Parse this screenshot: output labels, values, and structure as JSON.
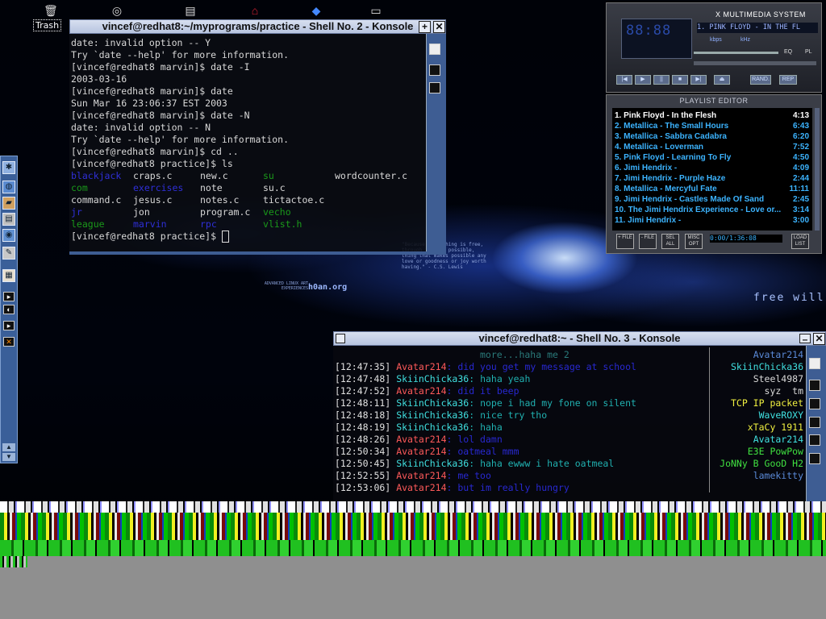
{
  "desktop": {
    "trash_label": "Trash",
    "wallpaper_free_will": "free will",
    "wallpaper_h0an": "h0an.org",
    "wallpaper_quote": "\"Because if a thing is free, through it also possible, thing that makes possible any love or goodness or joy worth having.\" - C.S. Lewis",
    "wallpaper_adv": "ADVANCED LINUX ART EXPERIENCES"
  },
  "shell2": {
    "title": "vincef@redhat8:~/myprograms/practice - Shell No. 2 - Konsole",
    "lines": [
      "date: invalid option -- Y",
      "Try `date --help' for more information.",
      "[vincef@redhat8 marvin]$ date -I",
      "2003-03-16",
      "[vincef@redhat8 marvin]$ date",
      "Sun Mar 16 23:06:37 EST 2003",
      "[vincef@redhat8 marvin]$ date -N",
      "date: invalid option -- N",
      "Try `date --help' for more information.",
      "[vincef@redhat8 marvin]$ cd ..",
      "[vincef@redhat8 practice]$ ls"
    ],
    "ls": [
      [
        "blackjack",
        "craps.c",
        "new.c",
        "su",
        "wordcounter.c"
      ],
      [
        "com",
        "exercises",
        "note",
        "su.c",
        ""
      ],
      [
        "command.c",
        "jesus.c",
        "notes.c",
        "tictactoe.c",
        ""
      ],
      [
        "jr",
        "jon",
        "program.c",
        "vecho",
        ""
      ],
      [
        "league",
        "marvin",
        "rpc",
        "vlist.h",
        ""
      ]
    ],
    "prompt": "[vincef@redhat8 practice]$ "
  },
  "shell3": {
    "title": "vincef@redhat8:~ - Shell No. 3 - Konsole",
    "top_line": "more...haha me 2",
    "chat": [
      {
        "ts": "[12:47:35]",
        "nick": "Avatar214",
        "msg": "did you get my message at school",
        "who": "a"
      },
      {
        "ts": "[12:47:48]",
        "nick": "SkiinChicka36",
        "msg": "haha yeah",
        "who": "s"
      },
      {
        "ts": "[12:47:52]",
        "nick": "Avatar214",
        "msg": "did it beep",
        "who": "a"
      },
      {
        "ts": "[12:48:11]",
        "nick": "SkiinChicka36",
        "msg": "nope i had my fone on silent",
        "who": "s"
      },
      {
        "ts": "[12:48:18]",
        "nick": "SkiinChicka36",
        "msg": "nice try tho",
        "who": "s"
      },
      {
        "ts": "[12:48:19]",
        "nick": "SkiinChicka36",
        "msg": "haha",
        "who": "s"
      },
      {
        "ts": "[12:48:26]",
        "nick": "Avatar214",
        "msg": "lol damn",
        "who": "a"
      },
      {
        "ts": "[12:50:34]",
        "nick": "Avatar214",
        "msg": "oatmeal mmm",
        "who": "a"
      },
      {
        "ts": "[12:50:45]",
        "nick": "SkiinChicka36",
        "msg": "haha ewww i hate oatmeal",
        "who": "s"
      },
      {
        "ts": "[12:52:55]",
        "nick": "Avatar214",
        "msg": "me too",
        "who": "a"
      },
      {
        "ts": "[12:53:06]",
        "nick": "Avatar214",
        "msg": "but im really hungry",
        "who": "a"
      }
    ],
    "users": [
      "Avatar214",
      "SkiinChicka36",
      "Steel4987",
      "syz  tm",
      "TCP IP packet",
      "WaveROXY",
      "xTaCy 1911",
      "Avatar214",
      "E3E PowPow",
      "JoNNy B GooD H2",
      "lamekitty"
    ]
  },
  "xmms": {
    "title": "X MULTIMEDIA SYSTEM",
    "time": "88:88",
    "track": "1. PINK FLOYD - IN THE FL",
    "kbps": "kbps",
    "khz": "kHz",
    "eq": "EQ",
    "pl": "PL",
    "rand": "RAND.",
    "rep": "REP"
  },
  "playlist": {
    "title": "PLAYLIST EDITOR",
    "items": [
      {
        "name": "1. Pink Floyd - In the Flesh",
        "dur": "4:13"
      },
      {
        "name": "2. Metallica - The Small Hours",
        "dur": "6:43"
      },
      {
        "name": "3. Metallica - Sabbra Cadabra",
        "dur": "6:20"
      },
      {
        "name": "4. Metallica - Loverman",
        "dur": "7:52"
      },
      {
        "name": "5. Pink Floyd - Learning To Fly",
        "dur": "4:50"
      },
      {
        "name": "6. Jimi Hendrix -",
        "dur": "4:09"
      },
      {
        "name": "7. Jimi Hendrix - Purple Haze",
        "dur": "2:44"
      },
      {
        "name": "8. Metallica - Mercyful Fate",
        "dur": "11:11"
      },
      {
        "name": "9. Jimi Hendrix - Castles Made Of Sand",
        "dur": "2:45"
      },
      {
        "name": "10. The Jimi Hendrix Experience - Love or...",
        "dur": "3:14"
      },
      {
        "name": "11. Jimi Hendrix -",
        "dur": "3:00"
      }
    ],
    "buttons": [
      "+ FILE",
      "- FILE",
      "SEL ALL",
      "MISC OPT",
      "LOAD LIST"
    ],
    "time": "0:00/1:36:08"
  },
  "colors": {
    "ls_blue": "#2f2fd8",
    "ls_green": "#1a9a1a",
    "playlist_text": "#3cb4ff",
    "nick_avatar": "#ff5a5a",
    "nick_skiin": "#40e0e0"
  }
}
